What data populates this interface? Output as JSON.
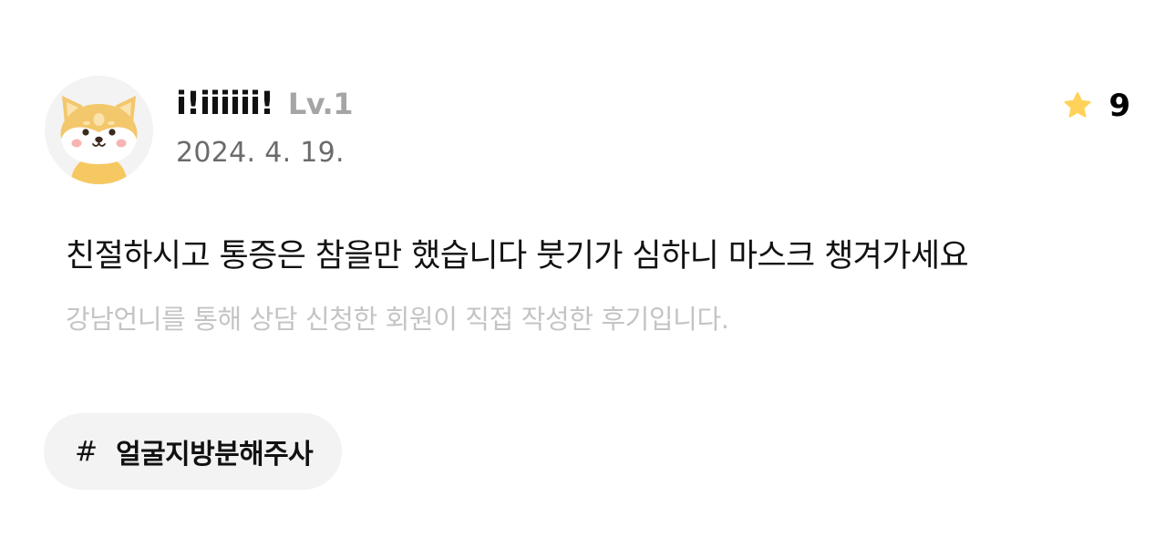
{
  "review": {
    "user": {
      "name": "i!iiiiii!",
      "level": "Lv.1",
      "avatar_icon": "shiba-dog-avatar-icon"
    },
    "date": "2024. 4. 19.",
    "rating": {
      "icon": "star-icon",
      "value": "9",
      "star_color": "#FFD25A"
    },
    "text": "친절하시고 통증은 참을만 했습니다 붓기가 심하니 마스크 챙겨가세요",
    "disclaimer": "강남언니를 통해 상담 신청한 회원이 직접 작성한 후기입니다.",
    "tag": {
      "hash": "#",
      "label": "얼굴지방분해주사"
    }
  }
}
